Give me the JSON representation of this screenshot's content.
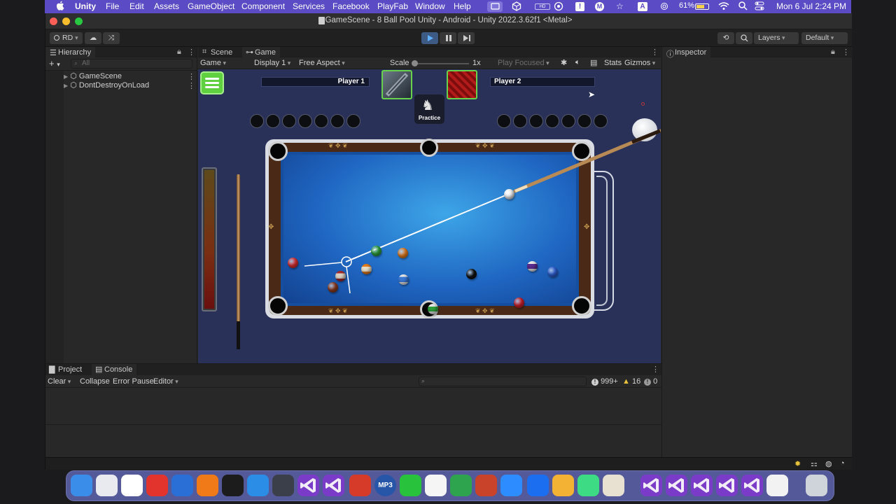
{
  "menubar": {
    "items": [
      "Unity",
      "File",
      "Edit",
      "Assets",
      "GameObject",
      "Component",
      "Services",
      "Facebook",
      "PlayFab",
      "Window",
      "Help"
    ],
    "battery": "61%",
    "clock": "Mon 6 Jul  2:24 PM",
    "status_icons": [
      "apple-icon",
      "display-icon",
      "unity-icon",
      "record-icon",
      "alert-icon",
      "menu-m-icon",
      "star-icon",
      "keyboard-a-icon",
      "airdrop-icon",
      "wifi-icon",
      "search-icon",
      "control-center-icon"
    ]
  },
  "window": {
    "title": "GameScene - 8 Ball Pool Unity - Android - Unity 2022.3.62f1 <Metal>"
  },
  "toolbar": {
    "account": "RD",
    "layers": "Layers",
    "layout": "Default"
  },
  "hierarchy": {
    "tab": "Hierarchy",
    "search_placeholder": "All",
    "rows": [
      "GameScene",
      "DontDestroyOnLoad"
    ]
  },
  "scene_tabs": {
    "scene": "Scene",
    "game": "Game"
  },
  "game_toolbar": {
    "mode": "Game",
    "display": "Display 1",
    "aspect": "Free Aspect",
    "scale_label": "Scale",
    "scale_value": "1x",
    "play_focused": "Play Focused",
    "stats": "Stats",
    "gizmos": "Gizmos"
  },
  "game": {
    "player1": "Player 1",
    "player2": "Player 2",
    "mode_label": "Practice",
    "power_level": 0.0
  },
  "inspector": {
    "tab": "Inspector"
  },
  "console": {
    "project_tab": "Project",
    "console_tab": "Console",
    "clear": "Clear",
    "collapse": "Collapse",
    "error_pause": "Error Pause",
    "editor": "Editor",
    "info_count": "999+",
    "warn_count": "16",
    "error_count": "0"
  },
  "colors": {
    "menubar": "#5b4bc4",
    "felt": "#1f66c2",
    "rail": "#4a2a17",
    "accent_green": "#62d24a",
    "game_bg": "#2a3159"
  },
  "dock": {
    "apps": [
      "finder-icon",
      "launchpad-icon",
      "chrome-icon",
      "anydesk-icon",
      "altstore-icon",
      "blender-icon",
      "activity-monitor-icon",
      "safari-icon",
      "unity-hub-icon",
      "visual-studio-icon",
      "visual-studio-icon",
      "remote-desktop-icon",
      "mp3-converter-icon",
      "whatsapp-icon",
      "freeform-icon",
      "numbers-icon",
      "powerpoint-icon",
      "zoom-icon",
      "roblox-icon",
      "store-icon",
      "android-studio-icon",
      "notes-icon",
      "visual-studio-icon",
      "visual-studio-icon",
      "visual-studio-icon",
      "visual-studio-icon",
      "visual-studio-icon",
      "unity-icon",
      "trash-icon"
    ],
    "mp3_label": "MP3"
  }
}
